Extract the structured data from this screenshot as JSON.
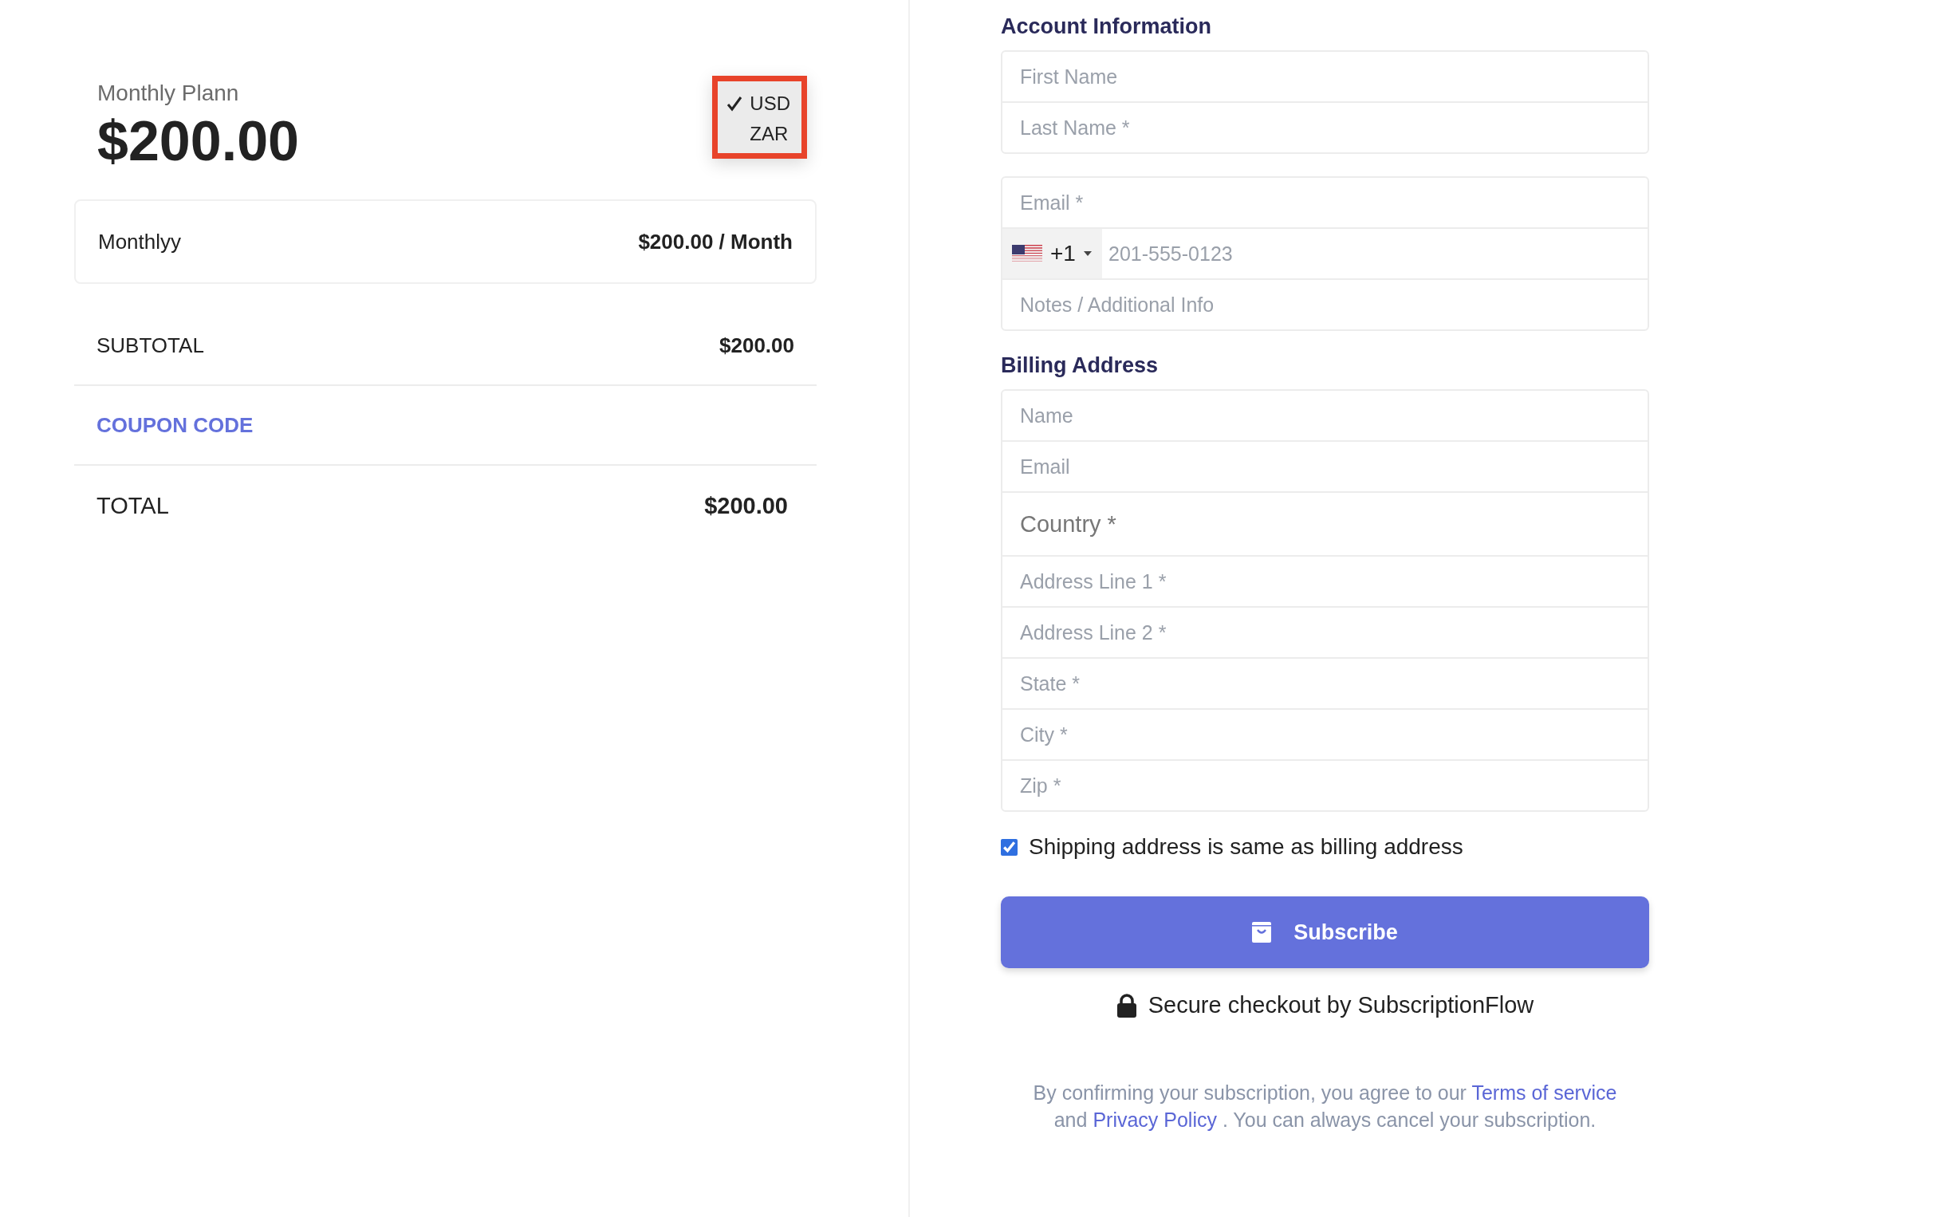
{
  "plan": {
    "name": "Monthly Plann",
    "price": "$200.00"
  },
  "currency_menu": {
    "options": [
      {
        "label": "USD",
        "selected": true
      },
      {
        "label": "ZAR",
        "selected": false
      }
    ]
  },
  "plan_card": {
    "name": "Monthlyy",
    "price": "$200.00 / Month"
  },
  "subtotal": {
    "label": "SUBTOTAL",
    "value": "$200.00"
  },
  "coupon": {
    "label": "COUPON CODE"
  },
  "total": {
    "label": "TOTAL",
    "value": "$200.00"
  },
  "account": {
    "title": "Account Information",
    "groups": [
      [
        {
          "kind": "text",
          "placeholder": "First Name"
        },
        {
          "kind": "text",
          "placeholder": "Last Name *"
        }
      ],
      [
        {
          "kind": "text",
          "placeholder": "Email *"
        },
        {
          "kind": "phone",
          "code": "+1",
          "placeholder": "201-555-0123"
        },
        {
          "kind": "text",
          "placeholder": "Notes / Additional Info"
        }
      ]
    ]
  },
  "billing": {
    "title": "Billing Address",
    "fields": [
      {
        "kind": "text",
        "placeholder": "Name"
      },
      {
        "kind": "text",
        "placeholder": "Email"
      },
      {
        "kind": "select",
        "placeholder": "Country *"
      },
      {
        "kind": "text",
        "placeholder": "Address Line 1 *"
      },
      {
        "kind": "text",
        "placeholder": "Address Line 2 *"
      },
      {
        "kind": "text",
        "placeholder": "State *"
      },
      {
        "kind": "text",
        "placeholder": "City *"
      },
      {
        "kind": "text",
        "placeholder": "Zip *"
      }
    ]
  },
  "shipping_same": {
    "label": "Shipping address is same as billing address",
    "checked": true
  },
  "subscribe_button": {
    "label": "Subscribe"
  },
  "secure_note": "Secure checkout by SubscriptionFlow",
  "legal": [
    {
      "kind": "text",
      "text": "By confirming your subscription, you agree to our "
    },
    {
      "kind": "link",
      "text": "Terms of service"
    },
    {
      "kind": "text",
      "text": " and "
    },
    {
      "kind": "link",
      "text": "Privacy Policy"
    },
    {
      "kind": "text",
      "text": " . You can always cancel your subscription."
    }
  ]
}
